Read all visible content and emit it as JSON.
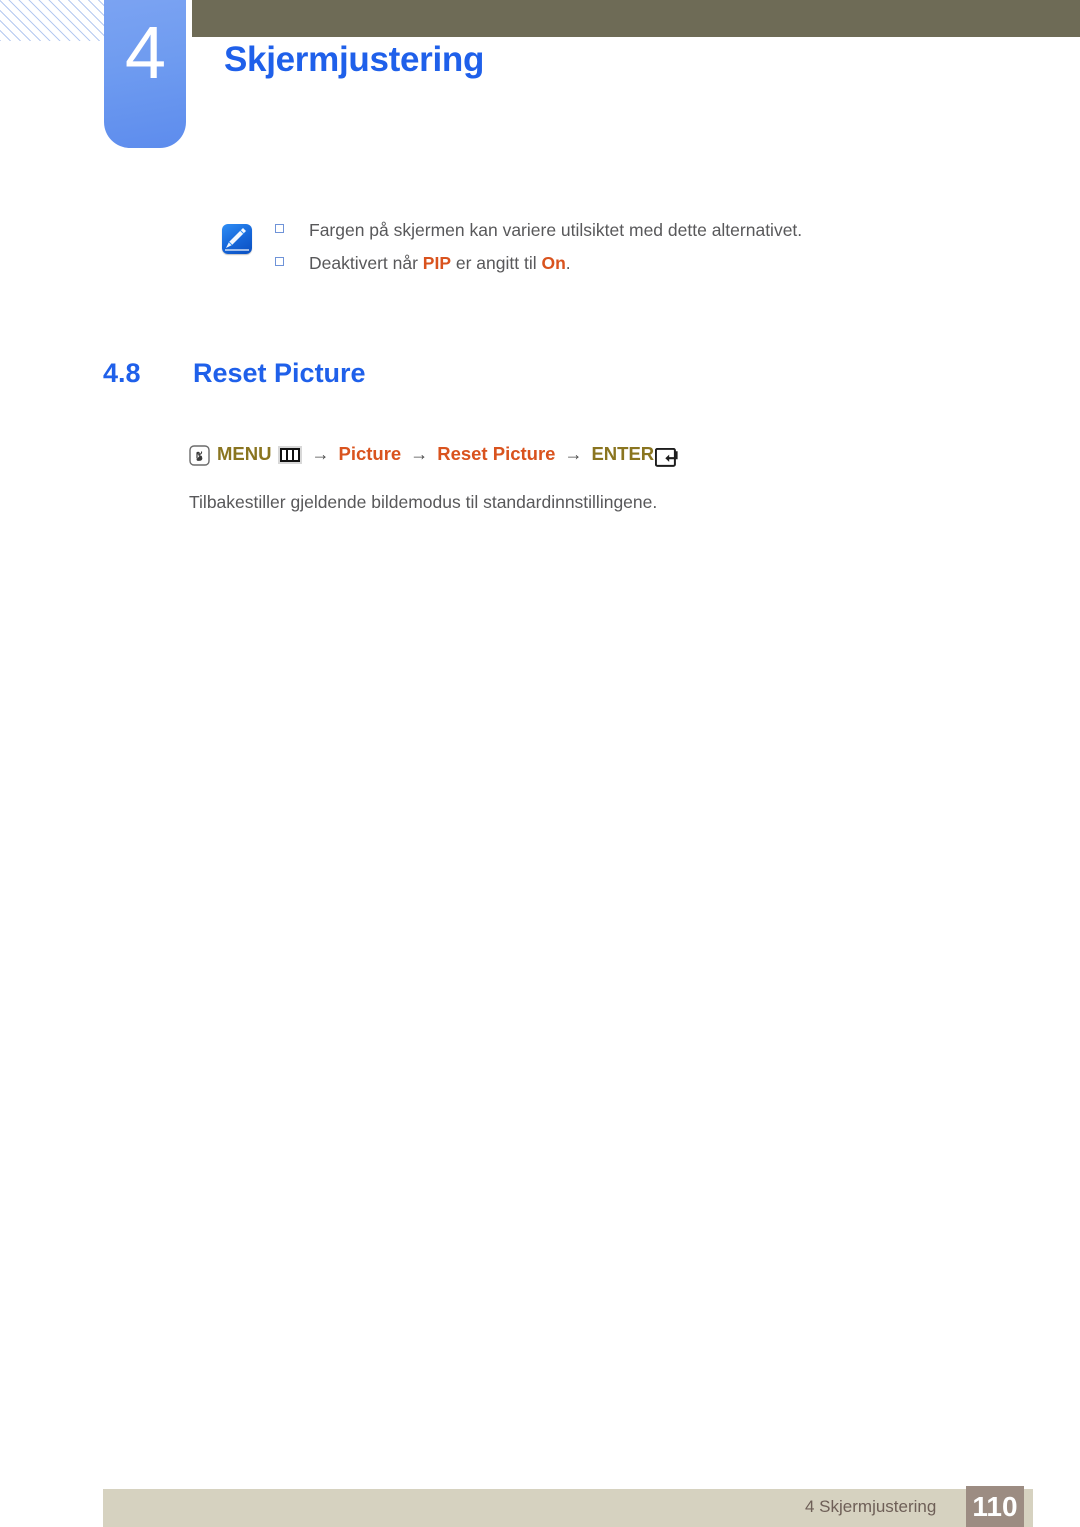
{
  "document": {
    "chapter_number": "4",
    "chapter_title": "Skjermjustering"
  },
  "note": {
    "icon": "note-pen-icon",
    "items": [
      {
        "text": "Fargen på skjermen kan variere utilsiktet med dette alternativet."
      },
      {
        "prefix": "Deaktivert når ",
        "term1": "PIP",
        "middle": " er angitt til ",
        "term2": "On",
        "suffix": "."
      }
    ]
  },
  "section": {
    "number": "4.8",
    "title": "Reset Picture"
  },
  "menu_path": {
    "hand_icon": "hand-press-icon",
    "menu_label": "MENU",
    "menu_icon": "menu-bars-icon",
    "arrow": "→",
    "step_picture": "Picture",
    "step_reset_picture": "Reset Picture",
    "enter_label": "ENTER",
    "enter_icon": "enter-key-icon"
  },
  "body": {
    "paragraph": "Tilbakestiller gjeldende bildemodus til standardinnstillingene."
  },
  "footer": {
    "label": "4 Skjermjustering",
    "page_number": "110"
  },
  "colors": {
    "accent_blue": "#1f60ea",
    "tab_blue": "#6e9bf0",
    "olive": "#6e6b56",
    "gold": "#8a7520",
    "orange": "#d9531e",
    "footer_bg": "#d6d2c0",
    "page_badge_bg": "#9c8c82",
    "body_text": "#58585a"
  }
}
